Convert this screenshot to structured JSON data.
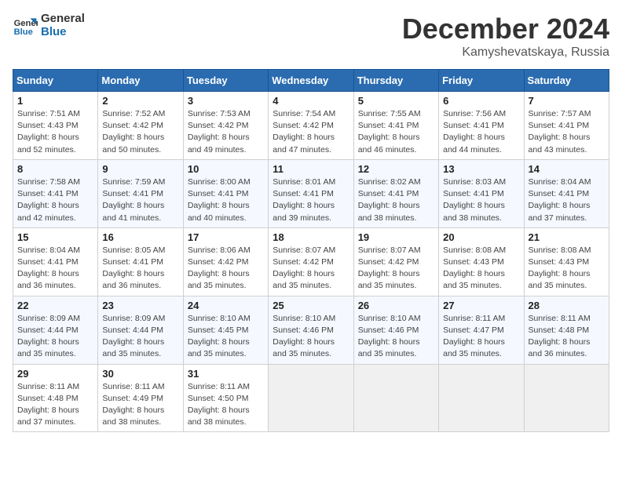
{
  "logo": {
    "line1": "General",
    "line2": "Blue"
  },
  "title": "December 2024",
  "location": "Kamyshevatskaya, Russia",
  "weekdays": [
    "Sunday",
    "Monday",
    "Tuesday",
    "Wednesday",
    "Thursday",
    "Friday",
    "Saturday"
  ],
  "weeks": [
    [
      {
        "day": "1",
        "sunrise": "7:51 AM",
        "sunset": "4:43 PM",
        "daylight": "8 hours and 52 minutes."
      },
      {
        "day": "2",
        "sunrise": "7:52 AM",
        "sunset": "4:42 PM",
        "daylight": "8 hours and 50 minutes."
      },
      {
        "day": "3",
        "sunrise": "7:53 AM",
        "sunset": "4:42 PM",
        "daylight": "8 hours and 49 minutes."
      },
      {
        "day": "4",
        "sunrise": "7:54 AM",
        "sunset": "4:42 PM",
        "daylight": "8 hours and 47 minutes."
      },
      {
        "day": "5",
        "sunrise": "7:55 AM",
        "sunset": "4:41 PM",
        "daylight": "8 hours and 46 minutes."
      },
      {
        "day": "6",
        "sunrise": "7:56 AM",
        "sunset": "4:41 PM",
        "daylight": "8 hours and 44 minutes."
      },
      {
        "day": "7",
        "sunrise": "7:57 AM",
        "sunset": "4:41 PM",
        "daylight": "8 hours and 43 minutes."
      }
    ],
    [
      {
        "day": "8",
        "sunrise": "7:58 AM",
        "sunset": "4:41 PM",
        "daylight": "8 hours and 42 minutes."
      },
      {
        "day": "9",
        "sunrise": "7:59 AM",
        "sunset": "4:41 PM",
        "daylight": "8 hours and 41 minutes."
      },
      {
        "day": "10",
        "sunrise": "8:00 AM",
        "sunset": "4:41 PM",
        "daylight": "8 hours and 40 minutes."
      },
      {
        "day": "11",
        "sunrise": "8:01 AM",
        "sunset": "4:41 PM",
        "daylight": "8 hours and 39 minutes."
      },
      {
        "day": "12",
        "sunrise": "8:02 AM",
        "sunset": "4:41 PM",
        "daylight": "8 hours and 38 minutes."
      },
      {
        "day": "13",
        "sunrise": "8:03 AM",
        "sunset": "4:41 PM",
        "daylight": "8 hours and 38 minutes."
      },
      {
        "day": "14",
        "sunrise": "8:04 AM",
        "sunset": "4:41 PM",
        "daylight": "8 hours and 37 minutes."
      }
    ],
    [
      {
        "day": "15",
        "sunrise": "8:04 AM",
        "sunset": "4:41 PM",
        "daylight": "8 hours and 36 minutes."
      },
      {
        "day": "16",
        "sunrise": "8:05 AM",
        "sunset": "4:41 PM",
        "daylight": "8 hours and 36 minutes."
      },
      {
        "day": "17",
        "sunrise": "8:06 AM",
        "sunset": "4:42 PM",
        "daylight": "8 hours and 35 minutes."
      },
      {
        "day": "18",
        "sunrise": "8:07 AM",
        "sunset": "4:42 PM",
        "daylight": "8 hours and 35 minutes."
      },
      {
        "day": "19",
        "sunrise": "8:07 AM",
        "sunset": "4:42 PM",
        "daylight": "8 hours and 35 minutes."
      },
      {
        "day": "20",
        "sunrise": "8:08 AM",
        "sunset": "4:43 PM",
        "daylight": "8 hours and 35 minutes."
      },
      {
        "day": "21",
        "sunrise": "8:08 AM",
        "sunset": "4:43 PM",
        "daylight": "8 hours and 35 minutes."
      }
    ],
    [
      {
        "day": "22",
        "sunrise": "8:09 AM",
        "sunset": "4:44 PM",
        "daylight": "8 hours and 35 minutes."
      },
      {
        "day": "23",
        "sunrise": "8:09 AM",
        "sunset": "4:44 PM",
        "daylight": "8 hours and 35 minutes."
      },
      {
        "day": "24",
        "sunrise": "8:10 AM",
        "sunset": "4:45 PM",
        "daylight": "8 hours and 35 minutes."
      },
      {
        "day": "25",
        "sunrise": "8:10 AM",
        "sunset": "4:46 PM",
        "daylight": "8 hours and 35 minutes."
      },
      {
        "day": "26",
        "sunrise": "8:10 AM",
        "sunset": "4:46 PM",
        "daylight": "8 hours and 35 minutes."
      },
      {
        "day": "27",
        "sunrise": "8:11 AM",
        "sunset": "4:47 PM",
        "daylight": "8 hours and 35 minutes."
      },
      {
        "day": "28",
        "sunrise": "8:11 AM",
        "sunset": "4:48 PM",
        "daylight": "8 hours and 36 minutes."
      }
    ],
    [
      {
        "day": "29",
        "sunrise": "8:11 AM",
        "sunset": "4:48 PM",
        "daylight": "8 hours and 37 minutes."
      },
      {
        "day": "30",
        "sunrise": "8:11 AM",
        "sunset": "4:49 PM",
        "daylight": "8 hours and 38 minutes."
      },
      {
        "day": "31",
        "sunrise": "8:11 AM",
        "sunset": "4:50 PM",
        "daylight": "8 hours and 38 minutes."
      },
      null,
      null,
      null,
      null
    ]
  ]
}
